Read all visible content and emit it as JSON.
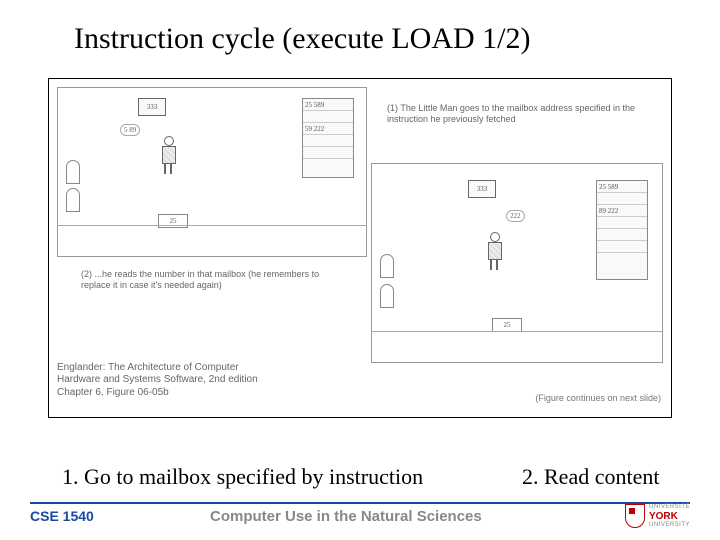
{
  "title": "Instruction cycle (execute LOAD 1/2)",
  "figure": {
    "panel1": {
      "calculator": "333",
      "speech": "5 89",
      "counter": "25",
      "mailboxes": [
        "25 589",
        "",
        "59 222"
      ],
      "note_num": "(1)",
      "note_text": "The Little Man goes to the mailbox address specified in the instruction he previously fetched"
    },
    "panel2": {
      "calculator": "333",
      "speech": "222",
      "counter": "25",
      "mailboxes": [
        "25 589",
        "",
        "89 222"
      ],
      "note_num": "(2)",
      "note_text": "...he reads the number in that mailbox (he remembers to replace it in case it's needed again)"
    },
    "citation_line1": "Englander: The Architecture of Computer",
    "citation_line2": "Hardware and Systems Software, 2nd edition",
    "citation_line3": "Chapter 6, Figure 06-05b",
    "continues": "(Figure continues on next slide)"
  },
  "captions": {
    "c1": "1. Go to mailbox specified by instruction",
    "c2": "2. Read content"
  },
  "footer": {
    "course_code": "CSE 1540",
    "course_title": "Computer Use in the Natural Sciences",
    "logo_uni": "UNIVERSITÉ",
    "logo_york": "YORK",
    "logo_sub": "UNIVERSITY"
  }
}
